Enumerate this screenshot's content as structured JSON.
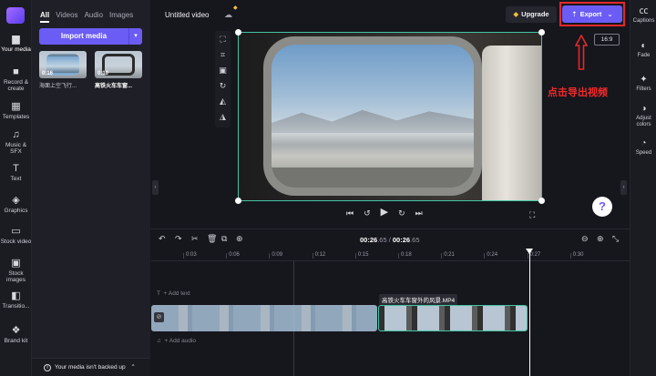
{
  "rail": {
    "items": [
      {
        "icon": "folder-icon",
        "label": "Your media",
        "glyph": "▆"
      },
      {
        "icon": "record-icon",
        "label": "Record & create",
        "glyph": "■"
      },
      {
        "icon": "templates-icon",
        "label": "Templates",
        "glyph": "▦"
      },
      {
        "icon": "music-icon",
        "label": "Music & SFX",
        "glyph": "♫"
      },
      {
        "icon": "text-icon",
        "label": "Text",
        "glyph": "T"
      },
      {
        "icon": "graphics-icon",
        "label": "Graphics",
        "glyph": "◈"
      },
      {
        "icon": "stock-video-icon",
        "label": "Stock video",
        "glyph": "▭"
      },
      {
        "icon": "stock-images-icon",
        "label": "Stock images",
        "glyph": "▣"
      },
      {
        "icon": "transitions-icon",
        "label": "Transitio...",
        "glyph": "◧"
      },
      {
        "icon": "brand-kit-icon",
        "label": "Brand kit",
        "glyph": "❖"
      }
    ]
  },
  "media": {
    "tabs": [
      "All",
      "Videos",
      "Audio",
      "Images"
    ],
    "import_label": "Import media",
    "thumbs": [
      {
        "duration": "0:16",
        "caption": "海面上空飞行..."
      },
      {
        "duration": "0:10",
        "caption": "高铁火车车窗..."
      }
    ],
    "backup_text": "Your media isn't backed up",
    "backup_chevron": "⌃"
  },
  "topbar": {
    "title": "Untitled video",
    "upgrade_label": "Upgrade",
    "export_label": "Export",
    "ratio": "16:9"
  },
  "annotation": {
    "text": "点击导出视频",
    "color": "#ef2b2b"
  },
  "right_rail": {
    "items": [
      {
        "icon": "captions-icon",
        "label": "Captions",
        "glyph": "㏄"
      },
      {
        "icon": "fade-icon",
        "label": "Fade",
        "glyph": "◐"
      },
      {
        "icon": "filters-icon",
        "label": "Filters",
        "glyph": "✦"
      },
      {
        "icon": "adjust-colors-icon",
        "label": "Adjust colors",
        "glyph": "◑"
      },
      {
        "icon": "speed-icon",
        "label": "Speed",
        "glyph": "◔"
      }
    ]
  },
  "playback": {
    "current": "00:26",
    "current_frac": ".65",
    "total": "00:26",
    "total_frac": ".65"
  },
  "timeline": {
    "ticks": [
      "0:03",
      "0:06",
      "0:09",
      "0:12",
      "0:15",
      "0:18",
      "0:21",
      "0:24",
      "0:27",
      "0:30"
    ],
    "add_text": "+ Add text",
    "add_audio": "+ Add audio",
    "clip_label": "高铁火车车窗外的风景.MP4"
  },
  "colors": {
    "accent": "#6b5cf6",
    "selection": "#43c5a4",
    "annotation": "#e22929"
  }
}
